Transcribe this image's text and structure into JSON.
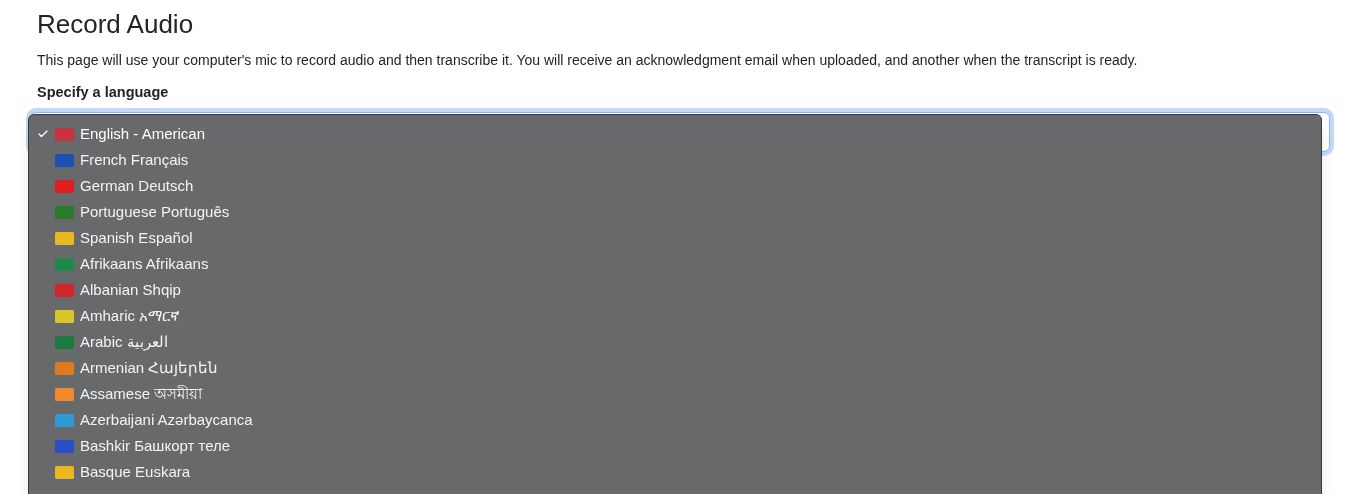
{
  "page": {
    "title": "Record Audio",
    "description": "This page will use your computer's mic to record audio and then transcribe it. You will receive an acknowledgment email when uploaded, and another when the transcript is ready."
  },
  "language_select": {
    "label": "Specify a language",
    "expanded": true,
    "options": [
      {
        "label": "English - American",
        "selected": true,
        "color": "#c8313e"
      },
      {
        "label": "French Français",
        "selected": false,
        "color": "#1e4fb4"
      },
      {
        "label": "German Deutsch",
        "selected": false,
        "color": "#dd1f1f"
      },
      {
        "label": "Portuguese Português",
        "selected": false,
        "color": "#2a7a2a"
      },
      {
        "label": "Spanish Español",
        "selected": false,
        "color": "#e8b81e"
      },
      {
        "label": "Afrikaans Afrikaans",
        "selected": false,
        "color": "#1b8a4a"
      },
      {
        "label": "Albanian Shqip",
        "selected": false,
        "color": "#d3262b"
      },
      {
        "label": "Amharic አማርኛ",
        "selected": false,
        "color": "#d9c62a"
      },
      {
        "label": "Arabic العربية",
        "selected": false,
        "color": "#1c7a3e"
      },
      {
        "label": "Armenian Հայերեն",
        "selected": false,
        "color": "#e07a1f"
      },
      {
        "label": "Assamese অসমীয়া",
        "selected": false,
        "color": "#f08a2a"
      },
      {
        "label": "Azerbaijani Azərbaycanca",
        "selected": false,
        "color": "#2f9ad6"
      },
      {
        "label": "Bashkir Башкорт теле",
        "selected": false,
        "color": "#2a4fc4"
      },
      {
        "label": "Basque Euskara",
        "selected": false,
        "color": "#e8b81e"
      }
    ]
  }
}
